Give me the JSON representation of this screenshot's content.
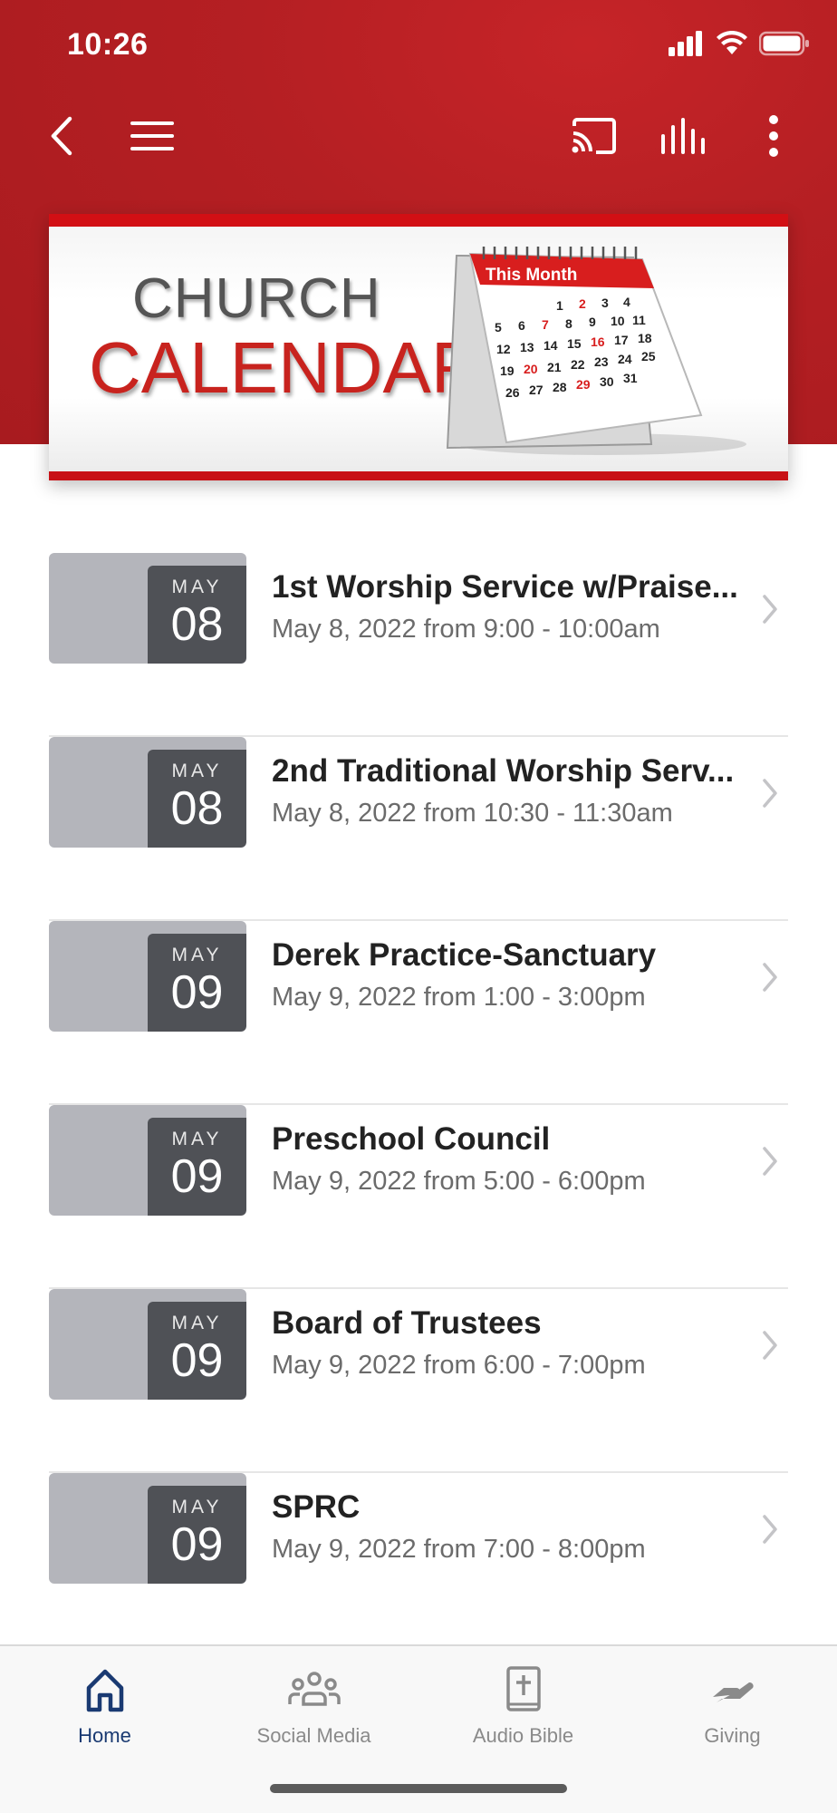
{
  "status_bar": {
    "time": "10:26"
  },
  "banner": {
    "line1": "CHURCH",
    "line2": "CALENDAR",
    "calendar_header": "This Month"
  },
  "events": [
    {
      "month": "MAY",
      "day": "08",
      "title": "1st Worship Service w/Praise...",
      "subtitle": "May 8, 2022 from 9:00 - 10:00am"
    },
    {
      "month": "MAY",
      "day": "08",
      "title": "2nd Traditional Worship Serv...",
      "subtitle": "May 8, 2022 from 10:30 - 11:30am"
    },
    {
      "month": "MAY",
      "day": "09",
      "title": "Derek Practice-Sanctuary",
      "subtitle": "May 9, 2022 from 1:00 - 3:00pm"
    },
    {
      "month": "MAY",
      "day": "09",
      "title": "Preschool Council",
      "subtitle": "May 9, 2022 from 5:00 - 6:00pm"
    },
    {
      "month": "MAY",
      "day": "09",
      "title": "Board of Trustees",
      "subtitle": "May 9, 2022 from 6:00 - 7:00pm"
    },
    {
      "month": "MAY",
      "day": "09",
      "title": "SPRC",
      "subtitle": "May 9, 2022 from 7:00 - 8:00pm"
    }
  ],
  "tabs": [
    {
      "label": "Home",
      "icon": "home-icon",
      "active": true
    },
    {
      "label": "Social Media",
      "icon": "people-icon",
      "active": false
    },
    {
      "label": "Audio Bible",
      "icon": "bible-icon",
      "active": false
    },
    {
      "label": "Giving",
      "icon": "giving-hand-icon",
      "active": false
    }
  ],
  "colors": {
    "brand_red": "#b51f23",
    "active_tab": "#1a3a72",
    "date_box": "#4f5156",
    "date_tile": "#b4b5bb"
  }
}
